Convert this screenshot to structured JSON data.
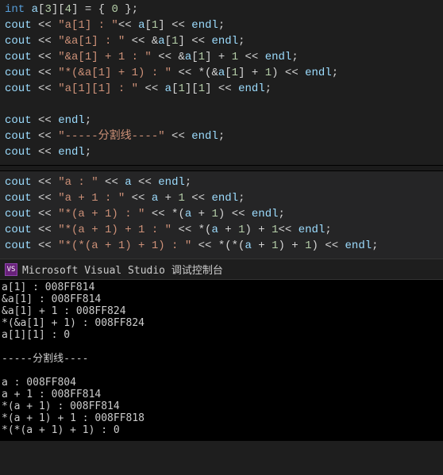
{
  "code1": [
    [
      [
        "kw",
        "int"
      ],
      [
        "op",
        " "
      ],
      [
        "id",
        "a"
      ],
      [
        "pun",
        "["
      ],
      [
        "num",
        "3"
      ],
      [
        "pun",
        "]["
      ],
      [
        "num",
        "4"
      ],
      [
        "pun",
        "]"
      ],
      [
        "op",
        " = { "
      ],
      [
        "num",
        "0"
      ],
      [
        "op",
        " };"
      ]
    ],
    [
      [
        "id",
        "cout"
      ],
      [
        "op",
        " << "
      ],
      [
        "str",
        "\"a[1] : \""
      ],
      [
        "op",
        "<< "
      ],
      [
        "id",
        "a"
      ],
      [
        "pun",
        "["
      ],
      [
        "num",
        "1"
      ],
      [
        "pun",
        "]"
      ],
      [
        "op",
        " << "
      ],
      [
        "id",
        "endl"
      ],
      [
        "pun",
        ";"
      ]
    ],
    [
      [
        "id",
        "cout"
      ],
      [
        "op",
        " << "
      ],
      [
        "str",
        "\"&a[1] : \""
      ],
      [
        "op",
        " << &"
      ],
      [
        "id",
        "a"
      ],
      [
        "pun",
        "["
      ],
      [
        "num",
        "1"
      ],
      [
        "pun",
        "]"
      ],
      [
        "op",
        " << "
      ],
      [
        "id",
        "endl"
      ],
      [
        "pun",
        ";"
      ]
    ],
    [
      [
        "id",
        "cout"
      ],
      [
        "op",
        " << "
      ],
      [
        "str",
        "\"&a[1] + 1 : \""
      ],
      [
        "op",
        " << &"
      ],
      [
        "id",
        "a"
      ],
      [
        "pun",
        "["
      ],
      [
        "num",
        "1"
      ],
      [
        "pun",
        "]"
      ],
      [
        "op",
        " + "
      ],
      [
        "num",
        "1"
      ],
      [
        "op",
        " << "
      ],
      [
        "id",
        "endl"
      ],
      [
        "pun",
        ";"
      ]
    ],
    [
      [
        "id",
        "cout"
      ],
      [
        "op",
        " << "
      ],
      [
        "str",
        "\"*(&a[1] + 1) : \""
      ],
      [
        "op",
        " << *(&"
      ],
      [
        "id",
        "a"
      ],
      [
        "pun",
        "["
      ],
      [
        "num",
        "1"
      ],
      [
        "pun",
        "]"
      ],
      [
        "op",
        " + "
      ],
      [
        "num",
        "1"
      ],
      [
        "op",
        ") << "
      ],
      [
        "id",
        "endl"
      ],
      [
        "pun",
        ";"
      ]
    ],
    [
      [
        "id",
        "cout"
      ],
      [
        "op",
        " << "
      ],
      [
        "str",
        "\"a[1][1] : \""
      ],
      [
        "op",
        " << "
      ],
      [
        "id",
        "a"
      ],
      [
        "pun",
        "["
      ],
      [
        "num",
        "1"
      ],
      [
        "pun",
        "]["
      ],
      [
        "num",
        "1"
      ],
      [
        "pun",
        "]"
      ],
      [
        "op",
        " << "
      ],
      [
        "id",
        "endl"
      ],
      [
        "pun",
        ";"
      ]
    ],
    [],
    [
      [
        "id",
        "cout"
      ],
      [
        "op",
        " << "
      ],
      [
        "id",
        "endl"
      ],
      [
        "pun",
        ";"
      ]
    ],
    [
      [
        "id",
        "cout"
      ],
      [
        "op",
        " << "
      ],
      [
        "str",
        "\"-----分割线----\""
      ],
      [
        "op",
        " << "
      ],
      [
        "id",
        "endl"
      ],
      [
        "pun",
        ";"
      ]
    ],
    [
      [
        "id",
        "cout"
      ],
      [
        "op",
        " << "
      ],
      [
        "id",
        "endl"
      ],
      [
        "pun",
        ";"
      ]
    ]
  ],
  "code2": [
    [
      [
        "id",
        "cout"
      ],
      [
        "op",
        " << "
      ],
      [
        "str",
        "\"a : \""
      ],
      [
        "op",
        " << "
      ],
      [
        "id",
        "a"
      ],
      [
        "op",
        " << "
      ],
      [
        "id",
        "endl"
      ],
      [
        "pun",
        ";"
      ]
    ],
    [
      [
        "id",
        "cout"
      ],
      [
        "op",
        " << "
      ],
      [
        "str",
        "\"a + 1 : \""
      ],
      [
        "op",
        " << "
      ],
      [
        "id",
        "a"
      ],
      [
        "op",
        " + "
      ],
      [
        "num",
        "1"
      ],
      [
        "op",
        " << "
      ],
      [
        "id",
        "endl"
      ],
      [
        "pun",
        ";"
      ]
    ],
    [
      [
        "id",
        "cout"
      ],
      [
        "op",
        " << "
      ],
      [
        "str",
        "\"*(a + 1) : \""
      ],
      [
        "op",
        " << *("
      ],
      [
        "id",
        "a"
      ],
      [
        "op",
        " + "
      ],
      [
        "num",
        "1"
      ],
      [
        "op",
        ") << "
      ],
      [
        "id",
        "endl"
      ],
      [
        "pun",
        ";"
      ]
    ],
    [
      [
        "id",
        "cout"
      ],
      [
        "op",
        " << "
      ],
      [
        "str",
        "\"*(a + 1) + 1 : \""
      ],
      [
        "op",
        " << *("
      ],
      [
        "id",
        "a"
      ],
      [
        "op",
        " + "
      ],
      [
        "num",
        "1"
      ],
      [
        "op",
        ") + "
      ],
      [
        "num",
        "1"
      ],
      [
        "op",
        "<< "
      ],
      [
        "id",
        "endl"
      ],
      [
        "pun",
        ";"
      ]
    ],
    [
      [
        "id",
        "cout"
      ],
      [
        "op",
        " << "
      ],
      [
        "str",
        "\"*(*(a + 1) + 1) : \""
      ],
      [
        "op",
        " << *(*("
      ],
      [
        "id",
        "a"
      ],
      [
        "op",
        " + "
      ],
      [
        "num",
        "1"
      ],
      [
        "op",
        ") + "
      ],
      [
        "num",
        "1"
      ],
      [
        "op",
        ") << "
      ],
      [
        "id",
        "endl"
      ],
      [
        "pun",
        ";"
      ]
    ]
  ],
  "console": {
    "icon_label": "VS",
    "title": "Microsoft Visual Studio 调试控制台",
    "lines": [
      "a[1] : 008FF814",
      "&a[1] : 008FF814",
      "&a[1] + 1 : 008FF824",
      "*(&a[1] + 1) : 008FF824",
      "a[1][1] : 0",
      "",
      "-----分割线----",
      "",
      "a : 008FF804",
      "a + 1 : 008FF814",
      "*(a + 1) : 008FF814",
      "*(a + 1) + 1 : 008FF818",
      "*(*(a + 1) + 1) : 0"
    ]
  }
}
